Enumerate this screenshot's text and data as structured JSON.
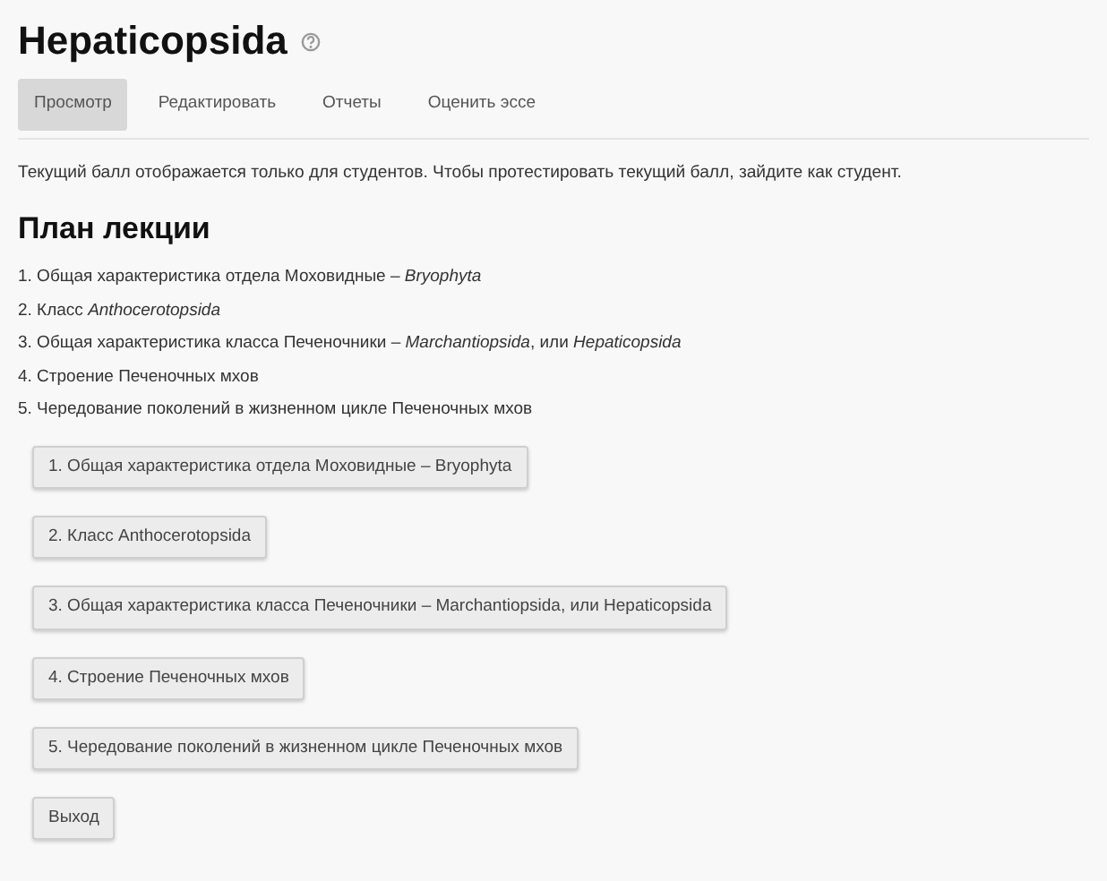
{
  "title": "Hepaticopsida",
  "tabs": [
    {
      "label": "Просмотр",
      "selected": true
    },
    {
      "label": "Редактировать",
      "selected": false
    },
    {
      "label": "Отчеты",
      "selected": false
    },
    {
      "label": "Оценить эссе",
      "selected": false
    }
  ],
  "notice": "Текущий балл отображается только для студентов. Чтобы протестировать текущий балл, зайдите как студент.",
  "plan": {
    "heading": "План лекции",
    "items": [
      "1. Общая характеристика отдела Моховидные – *Bryophyta*",
      "2. Класс *Anthocerotopsida*",
      "3. Общая характеристика класса Печеночники – *Marchantiopsida*, или *Hepaticopsida*",
      "4. Строение Печеночных мхов",
      "5. Чередование поколений в жизненном цикле Печеночных мхов"
    ]
  },
  "buttons": [
    "1. Общая характеристика отдела Моховидные – Bryophyta",
    "2. Класс Anthocerotopsida",
    "3. Общая характеристика класса Печеночники – Marchantiopsida, или Hepaticopsida",
    "4. Строение Печеночных мхов",
    "5. Чередование поколений в жизненном цикле Печеночных мхов",
    "Выход"
  ]
}
